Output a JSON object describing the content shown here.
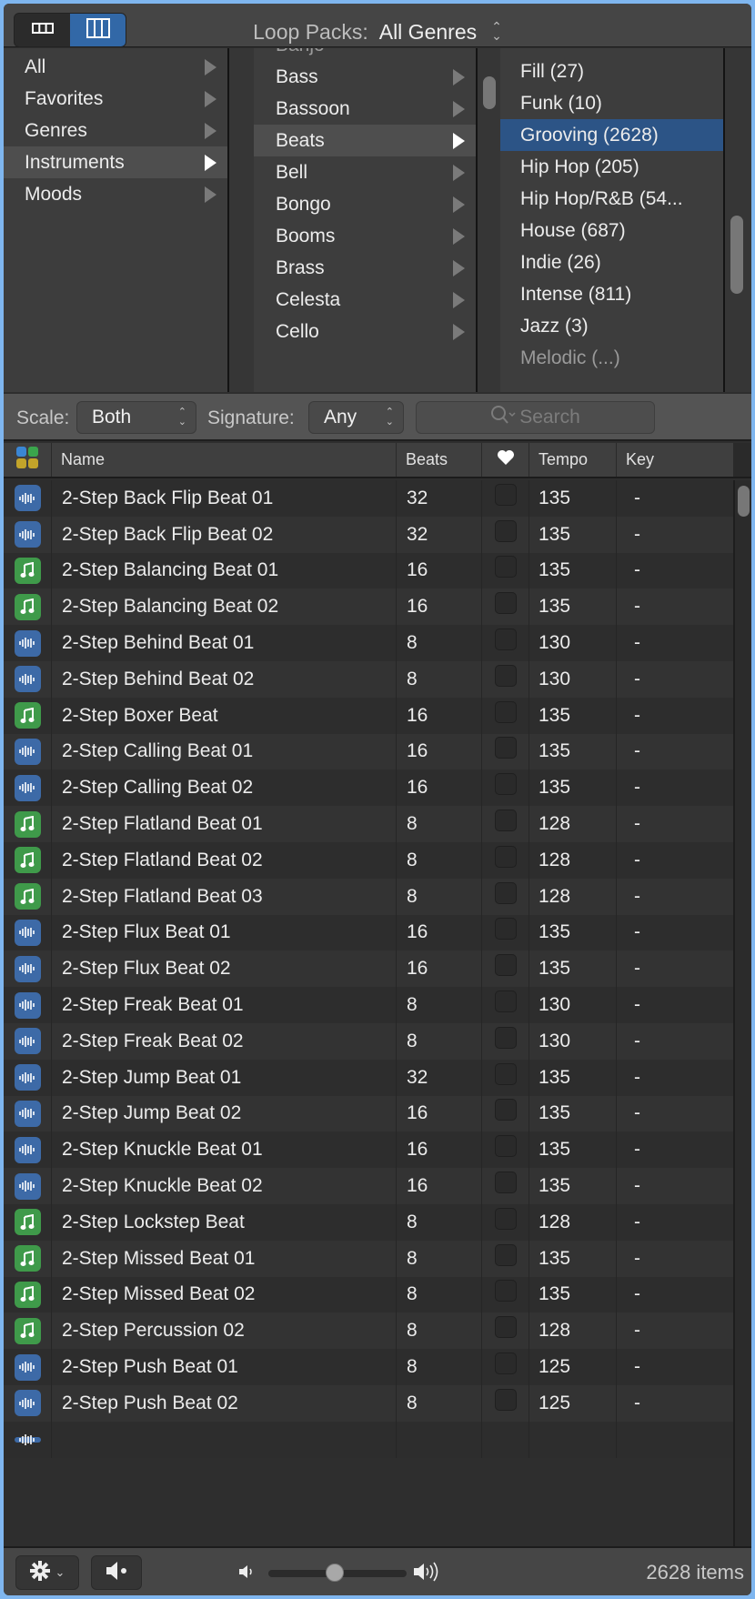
{
  "toolbar": {
    "view_buttons": [
      {
        "name": "list-view",
        "icon": "button-view-icon",
        "selected": false
      },
      {
        "name": "column-view",
        "icon": "column-view-icon",
        "selected": true
      }
    ],
    "loop_packs_label": "Loop Packs:",
    "loop_packs_value": "All Genres"
  },
  "browser": {
    "col1": [
      {
        "label": "All",
        "has_children": true,
        "selected": false
      },
      {
        "label": "Favorites",
        "has_children": true,
        "selected": false
      },
      {
        "label": "Genres",
        "has_children": true,
        "selected": false
      },
      {
        "label": "Instruments",
        "has_children": true,
        "selected": true
      },
      {
        "label": "Moods",
        "has_children": true,
        "selected": false
      }
    ],
    "col2": [
      {
        "label": "Banjo",
        "partial": true
      },
      {
        "label": "Bass"
      },
      {
        "label": "Bassoon"
      },
      {
        "label": "Beats",
        "selected": true
      },
      {
        "label": "Bell"
      },
      {
        "label": "Bongo"
      },
      {
        "label": "Booms"
      },
      {
        "label": "Brass"
      },
      {
        "label": "Celesta"
      },
      {
        "label": "Cello"
      }
    ],
    "col3": [
      {
        "label": "Fill (27)"
      },
      {
        "label": "Funk (10)"
      },
      {
        "label": "Grooving (2628)",
        "selected": true
      },
      {
        "label": "Hip Hop (205)"
      },
      {
        "label": "Hip Hop/R&B (54..."
      },
      {
        "label": "House (687)"
      },
      {
        "label": "Indie (26)"
      },
      {
        "label": "Intense (811)"
      },
      {
        "label": "Jazz (3)"
      },
      {
        "label": "Melodic (...)",
        "partial": true
      }
    ]
  },
  "filters": {
    "scale_label": "Scale:",
    "scale_value": "Both",
    "signature_label": "Signature:",
    "signature_value": "Any",
    "search_placeholder": "Search"
  },
  "table": {
    "columns": [
      "",
      "Name",
      "Beats",
      "favorite-heart",
      "Tempo",
      "Key"
    ],
    "header": {
      "name": "Name",
      "beats": "Beats",
      "tempo": "Tempo",
      "key": "Key"
    },
    "rows": [
      {
        "type": "audio",
        "name": "2-Step Back Flip Beat 01",
        "beats": "32",
        "fav": false,
        "tempo": "135",
        "key": "-"
      },
      {
        "type": "audio",
        "name": "2-Step Back Flip Beat 02",
        "beats": "32",
        "fav": false,
        "tempo": "135",
        "key": "-"
      },
      {
        "type": "midi",
        "name": "2-Step Balancing Beat 01",
        "beats": "16",
        "fav": false,
        "tempo": "135",
        "key": "-"
      },
      {
        "type": "midi",
        "name": "2-Step Balancing Beat 02",
        "beats": "16",
        "fav": false,
        "tempo": "135",
        "key": "-"
      },
      {
        "type": "audio",
        "name": "2-Step Behind Beat 01",
        "beats": "8",
        "fav": false,
        "tempo": "130",
        "key": "-"
      },
      {
        "type": "audio",
        "name": "2-Step Behind Beat 02",
        "beats": "8",
        "fav": false,
        "tempo": "130",
        "key": "-"
      },
      {
        "type": "midi",
        "name": "2-Step Boxer Beat",
        "beats": "16",
        "fav": false,
        "tempo": "135",
        "key": "-"
      },
      {
        "type": "audio",
        "name": "2-Step Calling Beat 01",
        "beats": "16",
        "fav": false,
        "tempo": "135",
        "key": "-"
      },
      {
        "type": "audio",
        "name": "2-Step Calling Beat 02",
        "beats": "16",
        "fav": false,
        "tempo": "135",
        "key": "-"
      },
      {
        "type": "midi",
        "name": "2-Step Flatland Beat 01",
        "beats": "8",
        "fav": false,
        "tempo": "128",
        "key": "-"
      },
      {
        "type": "midi",
        "name": "2-Step Flatland Beat 02",
        "beats": "8",
        "fav": false,
        "tempo": "128",
        "key": "-"
      },
      {
        "type": "midi",
        "name": "2-Step Flatland Beat 03",
        "beats": "8",
        "fav": false,
        "tempo": "128",
        "key": "-"
      },
      {
        "type": "audio",
        "name": "2-Step Flux Beat 01",
        "beats": "16",
        "fav": false,
        "tempo": "135",
        "key": "-"
      },
      {
        "type": "audio",
        "name": "2-Step Flux Beat 02",
        "beats": "16",
        "fav": false,
        "tempo": "135",
        "key": "-"
      },
      {
        "type": "audio",
        "name": "2-Step Freak Beat 01",
        "beats": "8",
        "fav": false,
        "tempo": "130",
        "key": "-"
      },
      {
        "type": "audio",
        "name": "2-Step Freak Beat 02",
        "beats": "8",
        "fav": false,
        "tempo": "130",
        "key": "-"
      },
      {
        "type": "audio",
        "name": "2-Step Jump Beat 01",
        "beats": "32",
        "fav": false,
        "tempo": "135",
        "key": "-"
      },
      {
        "type": "audio",
        "name": "2-Step Jump Beat 02",
        "beats": "16",
        "fav": false,
        "tempo": "135",
        "key": "-"
      },
      {
        "type": "audio",
        "name": "2-Step Knuckle Beat 01",
        "beats": "16",
        "fav": false,
        "tempo": "135",
        "key": "-"
      },
      {
        "type": "audio",
        "name": "2-Step Knuckle Beat 02",
        "beats": "16",
        "fav": false,
        "tempo": "135",
        "key": "-"
      },
      {
        "type": "midi",
        "name": "2-Step Lockstep Beat",
        "beats": "8",
        "fav": false,
        "tempo": "128",
        "key": "-"
      },
      {
        "type": "midi",
        "name": "2-Step Missed Beat 01",
        "beats": "8",
        "fav": false,
        "tempo": "135",
        "key": "-"
      },
      {
        "type": "midi",
        "name": "2-Step Missed Beat 02",
        "beats": "8",
        "fav": false,
        "tempo": "135",
        "key": "-"
      },
      {
        "type": "midi",
        "name": "2-Step Percussion 02",
        "beats": "8",
        "fav": false,
        "tempo": "128",
        "key": "-"
      },
      {
        "type": "audio",
        "name": "2-Step Push Beat 01",
        "beats": "8",
        "fav": false,
        "tempo": "125",
        "key": "-"
      },
      {
        "type": "audio",
        "name": "2-Step Push Beat 02",
        "beats": "8",
        "fav": false,
        "tempo": "125",
        "key": "-"
      },
      {
        "type": "audio",
        "name": "",
        "beats": "",
        "fav": false,
        "tempo": "",
        "key": "",
        "partial": true
      }
    ]
  },
  "bottom": {
    "action_menu_icon": "gear-icon",
    "preview_icon": "speaker-icon",
    "volume_fraction": 0.48,
    "item_count": "2628 items"
  },
  "colors": {
    "accent_blue": "#2c5486",
    "audio_icon": "#3d6aa7",
    "midi_icon": "#3f9a4a",
    "window_border": "#7fb6ef"
  }
}
